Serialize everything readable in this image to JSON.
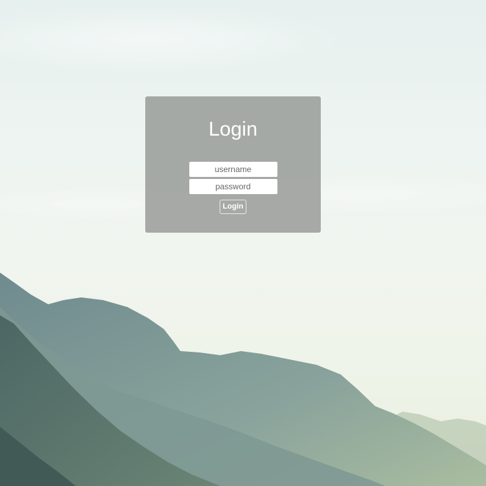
{
  "login": {
    "title": "Login",
    "username_placeholder": "username",
    "password_placeholder": "password",
    "button_label": "Login"
  },
  "colors": {
    "panel_background": "#9b9e9b",
    "title_text": "#ffffff",
    "input_background": "#ffffff",
    "button_border": "#e8e8e8"
  }
}
